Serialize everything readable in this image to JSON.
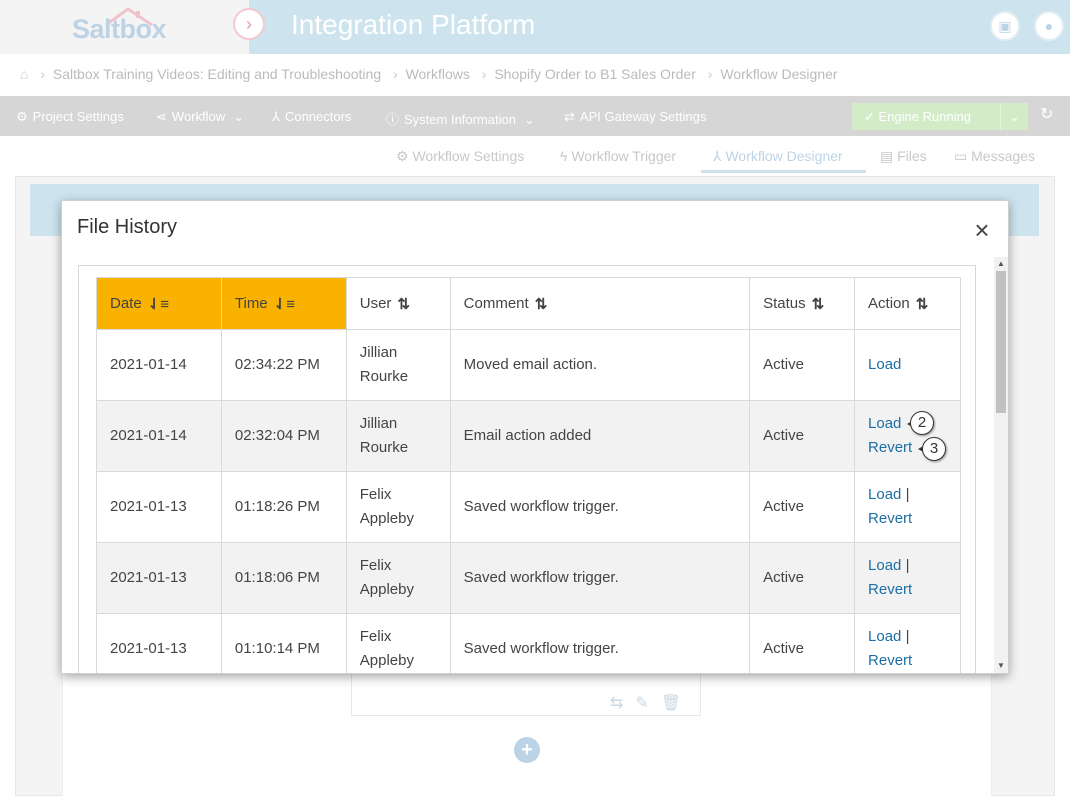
{
  "header": {
    "logo_text": "Saltbox",
    "app_title": "Integration Platform"
  },
  "breadcrumb": [
    "Saltbox Training Videos: Editing and Troubleshooting",
    "Workflows",
    "Shopify Order to B1 Sales Order",
    "Workflow Designer"
  ],
  "toolbar": {
    "project_settings": "Project Settings",
    "workflow": "Workflow",
    "connectors": "Connectors",
    "system_information": "System Information",
    "api_gateway": "API Gateway Settings",
    "engine_status": "Engine Running"
  },
  "subtabs": {
    "workflow_settings": "Workflow Settings",
    "workflow_trigger": "Workflow Trigger",
    "workflow_designer": "Workflow Designer",
    "files": "Files",
    "messages": "Messages"
  },
  "modal": {
    "title": "File History",
    "columns": {
      "date": "Date",
      "time": "Time",
      "user": "User",
      "comment": "Comment",
      "status": "Status",
      "action": "Action"
    },
    "rows": [
      {
        "date": "2021-01-14",
        "time": "02:34:22 PM",
        "user_first": "Jillian",
        "user_last": "Rourke",
        "comment": "Moved email action.",
        "status": "Active",
        "load": "Load"
      },
      {
        "date": "2021-01-14",
        "time": "02:32:04 PM",
        "user_first": "Jillian",
        "user_last": "Rourke",
        "comment": "Email action added",
        "status": "Active",
        "load": "Load",
        "revert": "Revert"
      },
      {
        "date": "2021-01-13",
        "time": "01:18:26 PM",
        "user_first": "Felix",
        "user_last": "Appleby",
        "comment": "Saved workflow trigger.",
        "status": "Active",
        "load": "Load",
        "revert": "Revert"
      },
      {
        "date": "2021-01-13",
        "time": "01:18:06 PM",
        "user_first": "Felix",
        "user_last": "Appleby",
        "comment": "Saved workflow trigger.",
        "status": "Active",
        "load": "Load",
        "revert": "Revert"
      },
      {
        "date": "2021-01-13",
        "time": "01:10:14 PM",
        "user_first": "Felix",
        "user_last": "Appleby",
        "comment": "Saved workflow trigger.",
        "status": "Active",
        "load": "Load",
        "revert": "Revert"
      }
    ],
    "action_separator": "|"
  },
  "callouts": [
    "2",
    "3"
  ],
  "colors": {
    "sorted_header": "#f9b200",
    "link": "#1d6fa5",
    "topbar": "#cde4ef"
  }
}
